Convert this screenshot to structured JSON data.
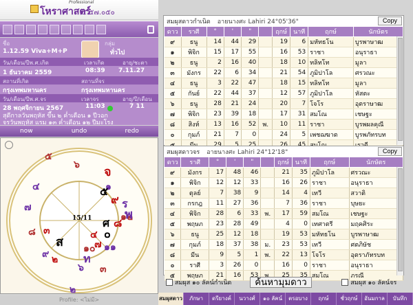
{
  "app": {
    "brand": "โหราศาสตร์",
    "version": "๕.๕๗.๐๕๐",
    "edition": "Professional"
  },
  "info": {
    "name_label": "ชื่อ",
    "name": "",
    "group_label": "กลุ่ม",
    "group": "ทั่วไป",
    "subject": "1.12.59 Viva+M+P",
    "birth_date_label": "วัน/เดือน/ปีพ.ศ.เกิด",
    "birth_time_label": "เวลาเกิด",
    "age_label": "อายุ/ชะตา",
    "birth_date": "1 ธันวาคม 2559",
    "birth_time": "08:39",
    "age": "7.11.27",
    "birth_place_label": "สถานที่เกิด",
    "current_place_label": "สถานที่จร",
    "birth_place": "กรุงเทพมหานคร",
    "current_place": "กรุงเทพมหานคร",
    "transit_date_label": "วัน/เดือน/ปีพ.ศ.จร",
    "transit_time_label": "เวลาจร",
    "transit_age_label": "อายุ/ปี/เดือน",
    "transit_date": "28 พฤศจิกายน 2567",
    "transit_time": "11:03",
    "transit_age": "7 11",
    "note1": "สุดีกาลวันพฤหัส ขึ้น ๒ ค่ำเดือน ๑ ปีวอก",
    "note2": "จรวันพฤหัส แรม ๑๓ ค่ำเดือน ๑๒ ปีมะโรง"
  },
  "nav": {
    "now": "now",
    "undo": "undo",
    "redo": "redo"
  },
  "chart": {
    "houses": [
      "๕",
      "๖",
      "๗",
      "๘",
      "๙",
      "๑๐",
      "๑๑",
      "๑๒",
      "๑",
      "๒",
      "๓",
      "๔"
    ],
    "center": "15/11",
    "planets": [
      "จ",
      "๕",
      "๙",
      "ร",
      "พ",
      "ศ",
      "๘",
      "๐",
      "๗",
      "๔",
      "ส",
      "๓",
      "๒",
      "ท",
      "๖"
    ]
  },
  "status": {
    "profile": "Profile: <ไม่มี>"
  },
  "birth_table": {
    "title": "สมผุสดาวกำเนิด",
    "ayanamsa": "อายนางศะ Lahiri  24°05'36\"",
    "copy": "Copy",
    "headers": [
      "ดาว",
      "ราศี",
      "°",
      "'",
      "\"",
      "",
      "ฤกษ์",
      "นาที",
      "ฤกษ์",
      "นักษัตร"
    ],
    "rows": [
      [
        "๙",
        "ธนู",
        "14",
        "44",
        "29",
        "",
        "19",
        "6",
        "มหัทธโน",
        "บูรพาษาฒ"
      ],
      [
        "๑",
        "พิจิก",
        "15",
        "17",
        "55",
        "",
        "16",
        "53",
        "ราชา",
        "อนุราธา"
      ],
      [
        "๒",
        "ธนู",
        "2",
        "16",
        "40",
        "",
        "18",
        "10",
        "ทลิทโท",
        "มูลา"
      ],
      [
        "๓",
        "มังกร",
        "22",
        "6",
        "34",
        "",
        "21",
        "54",
        "ภูมิปาโล",
        "ศรวณะ"
      ],
      [
        "๔",
        "ธนู",
        "3",
        "22",
        "47",
        "",
        "18",
        "15",
        "ทลิทโท",
        "มูลา"
      ],
      [
        "๕",
        "กันย์",
        "22",
        "44",
        "37",
        "",
        "12",
        "57",
        "ภูมิปาโล",
        "หัสตะ"
      ],
      [
        "๖",
        "ธนู",
        "28",
        "21",
        "24",
        "",
        "20",
        "7",
        "โจโร",
        "อุตราษาฒ"
      ],
      [
        "๗",
        "พิจิก",
        "23",
        "39",
        "18",
        "",
        "17",
        "31",
        "สมโณ",
        "เชษฐะ"
      ],
      [
        "๘",
        "สิงห์",
        "13",
        "16",
        "52",
        "พ.",
        "10",
        "11",
        "ราชา",
        "บูรพผลคุณี"
      ],
      [
        "๐",
        "กุมภ์",
        "21",
        "7",
        "0",
        "",
        "24",
        "5",
        "เพชฌฆาต",
        "บูรพภัทรบท"
      ],
      [
        "๕",
        "มีน",
        "29",
        "5",
        "25",
        "",
        "26",
        "45",
        "สมโณ",
        "เรวดี"
      ]
    ]
  },
  "transit_table": {
    "title": "สมผุสดาวจร",
    "ayanamsa": "อายนางศะ Lahiri  24°12'18\"",
    "copy": "Copy",
    "headers": [
      "ดาว",
      "ราศี",
      "°",
      "'",
      "\"",
      "",
      "ฤกษ์",
      "นาที",
      "ฤกษ์",
      "นักษัตร"
    ],
    "rows": [
      [
        "๙",
        "มังกร",
        "17",
        "48",
        "46",
        "",
        "21",
        "35",
        "ภูมิปาโล",
        "ศรวณะ"
      ],
      [
        "๑",
        "พิจิก",
        "12",
        "12",
        "33",
        "",
        "16",
        "26",
        "ราชา",
        "อนุราธา"
      ],
      [
        "๒",
        "ตุลย์",
        "7",
        "38",
        "9",
        "",
        "14",
        "4",
        "เทวี",
        "สวาติ"
      ],
      [
        "๓",
        "กรกฎ",
        "11",
        "27",
        "36",
        "",
        "7",
        "36",
        "ราชา",
        "บุษยะ"
      ],
      [
        "๔",
        "พิจิก",
        "28",
        "6",
        "33",
        "พ.",
        "17",
        "59",
        "สมโณ",
        "เชษฐะ"
      ],
      [
        "๕",
        "พฤษภ",
        "23",
        "28",
        "49",
        "",
        "4",
        "0",
        "เทศาตรี",
        "มฤคศิระ"
      ],
      [
        "๖",
        "ธนู",
        "25",
        "12",
        "18",
        "",
        "19",
        "53",
        "มหัทธโน",
        "บูรพาษาฒ"
      ],
      [
        "๗",
        "กุมภ์",
        "18",
        "37",
        "38",
        "ม.",
        "23",
        "53",
        "เทวี",
        "ศตภิษัช"
      ],
      [
        "๘",
        "มีน",
        "9",
        "5",
        "1",
        "พ.",
        "22",
        "13",
        "โจโร",
        "อุตราภัทรบท"
      ],
      [
        "๐",
        "ราศี",
        "3",
        "26",
        "0",
        "",
        "16",
        "0",
        "ราชา",
        "อนุราธา"
      ],
      [
        "๕",
        "พฤษภ",
        "21",
        "16",
        "53",
        "พ.",
        "25",
        "35",
        "สมโณ",
        "ภรณี"
      ]
    ]
  },
  "options": {
    "chk1": "สมผุส ๑๐ ลัคน์กำเนิด",
    "find": "ค้นหามุมดาว",
    "chk2": "สมผุส ๑๐ ลัคน์จร"
  },
  "tabs": [
    "สมผุสดาว",
    "ภักษา",
    "ดรียางค์",
    "นวางศ์",
    "๑๐ ลัคน์",
    "ตรอบาง",
    "ฤกษ์",
    "ชั่วฤกษ์",
    "อันมกาล",
    "บันทึก"
  ]
}
